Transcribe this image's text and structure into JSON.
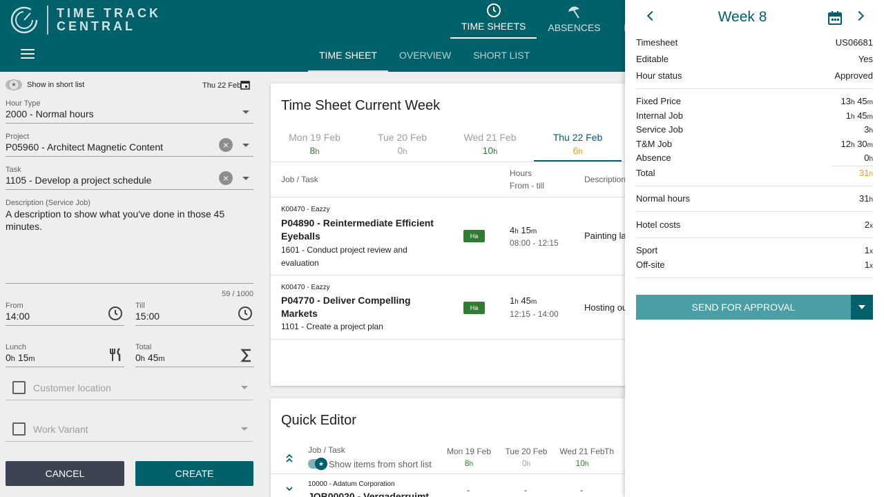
{
  "app": {
    "logo_line1": "TIME TRACK",
    "logo_line2": "CENTRAL"
  },
  "top_nav": [
    {
      "label": "TIME SHEETS",
      "icon": "clock-icon"
    },
    {
      "label": "ABSENCES",
      "icon": "umbrella-icon"
    },
    {
      "label": "EX",
      "icon": "expenses-icon"
    }
  ],
  "sub_nav": [
    "TIME SHEET",
    "OVERVIEW",
    "SHORT LIST"
  ],
  "form": {
    "short_list_label": "Show in short list",
    "date": "Thu 22 Feb",
    "hour_type": {
      "label": "Hour Type",
      "value": "2000 - Normal hours"
    },
    "project": {
      "label": "Project",
      "value": "P05960 - Architect Magnetic Content"
    },
    "task": {
      "label": "Task",
      "value": "1105 - Develop a project schedule"
    },
    "description": {
      "label": "Description (Service Job)",
      "value": "A description to show what you've done in those 45 minutes.",
      "count": "59 / 1000"
    },
    "from": {
      "label": "From",
      "value": "14:00"
    },
    "till": {
      "label": "Till",
      "value": "15:00"
    },
    "lunch": {
      "label": "Lunch",
      "value_h": "0",
      "value_m": "15"
    },
    "total": {
      "label": "Total",
      "value_h": "0",
      "value_m": "45"
    },
    "customer_location": "Customer location",
    "work_variant": "Work Variant",
    "cancel_label": "CANCEL",
    "create_label": "CREATE"
  },
  "timesheet": {
    "title": "Time Sheet Current Week",
    "days": [
      {
        "label": "Mon 19 Feb",
        "hours": "8",
        "color": "#2e7d32"
      },
      {
        "label": "Tue 20 Feb",
        "hours": "0",
        "color": "#9e9e9e"
      },
      {
        "label": "Wed 21 Feb",
        "hours": "10",
        "color": "#2e7d32"
      },
      {
        "label": "Thu 22 Feb",
        "hours": "6",
        "color": "#e0a020"
      }
    ],
    "col_job": "Job / Task",
    "col_hours": "Hours",
    "col_from_till": "From - till",
    "col_desc": "Description",
    "rows": [
      {
        "client": "K00470 - Eazzy",
        "project": "P04890 - Reintermediate Efficient Eyeballs",
        "task": "1601 - Conduct project review and evaluation",
        "badge": "Ha",
        "h": "4",
        "m": "15",
        "range": "08:00 - 12:15",
        "desc": "Painting la"
      },
      {
        "client": "K00470 - Eazzy",
        "project": "P04770 - Deliver Compelling Markets",
        "task": "1101 - Create a project plan",
        "badge": "Ha",
        "h": "1",
        "m": "45",
        "range": "12:15 - 14:00",
        "desc": "Hosting ou"
      }
    ]
  },
  "quick_editor": {
    "title": "Quick Editor",
    "col_job": "Job / Task",
    "short_list_toggle": "Show items from short list",
    "days": [
      {
        "label": "Mon 19 Feb",
        "hours": "8",
        "color": "#2e7d32"
      },
      {
        "label": "Tue 20 Feb",
        "hours": "0",
        "color": "#9e9e9e"
      },
      {
        "label": "Wed 21 Feb",
        "hours": "10",
        "color": "#2e7d32"
      },
      {
        "label": "Th",
        "hours": "",
        "color": "#2e7d32"
      }
    ],
    "row_client": "10000 - Adatum Corporation",
    "row_project": "JOB00020 - Vergaderruimt",
    "row_values": [
      "-",
      "-",
      "-"
    ]
  },
  "panel": {
    "week": "Week 8",
    "timesheet": {
      "label": "Timesheet",
      "value": "US06681"
    },
    "editable": {
      "label": "Editable",
      "value": "Yes"
    },
    "hour_status": {
      "label": "Hour status",
      "value": "Approved"
    },
    "fixed_price": {
      "label": "Fixed Price",
      "h": "13",
      "m": "45"
    },
    "internal_job": {
      "label": "Internal Job",
      "h": "1",
      "m": "45"
    },
    "service_job": {
      "label": "Service Job",
      "h": "3"
    },
    "tm_job": {
      "label": "T&M Job",
      "h": "12",
      "m": "30"
    },
    "absence": {
      "label": "Absence",
      "h": "0"
    },
    "total": {
      "label": "Total",
      "h": "31"
    },
    "normal_hours": {
      "label": "Normal hours",
      "h": "31"
    },
    "hotel_costs": {
      "label": "Hotel costs",
      "x": "2"
    },
    "sport": {
      "label": "Sport",
      "x": "1"
    },
    "off_site": {
      "label": "Off-site",
      "x": "1"
    },
    "approve_label": "SEND FOR APPROVAL",
    "unit_h": "h",
    "unit_m": "m",
    "unit_x": "x"
  },
  "colors": {
    "brand": "#00616b",
    "accent": "#4a9fa5",
    "total": "#e0a020"
  }
}
